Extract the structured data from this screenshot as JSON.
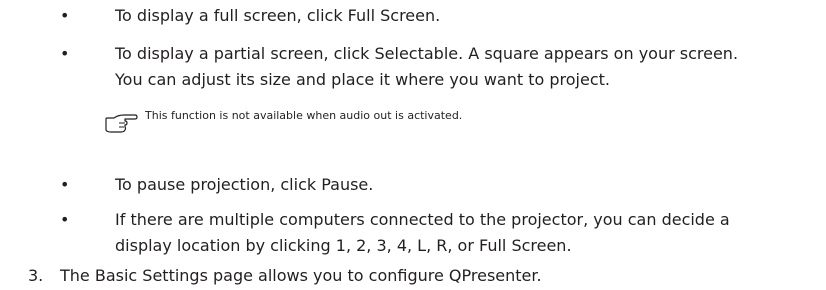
{
  "bullet_symbol": "•",
  "bullets": [
    {
      "lines": [
        "To display a full screen, click Full Screen."
      ]
    },
    {
      "lines": [
        "To display a partial screen, click Selectable. A square appears on your screen.",
        "You can adjust its size and place it where you want to project."
      ]
    },
    {
      "lines": [
        "To pause projection, click Pause."
      ]
    },
    {
      "lines": [
        "If there are multiple computers connected to the projector, you can decide a",
        "display location by clicking 1, 2, 3, 4, L, R, or Full Screen."
      ]
    }
  ],
  "note": {
    "icon": "pointing-hand-icon",
    "text": "This function is not available when audio out is activated."
  },
  "step": {
    "number": "3.",
    "text": "The Basic Settings page allows you to configure QPresenter."
  }
}
